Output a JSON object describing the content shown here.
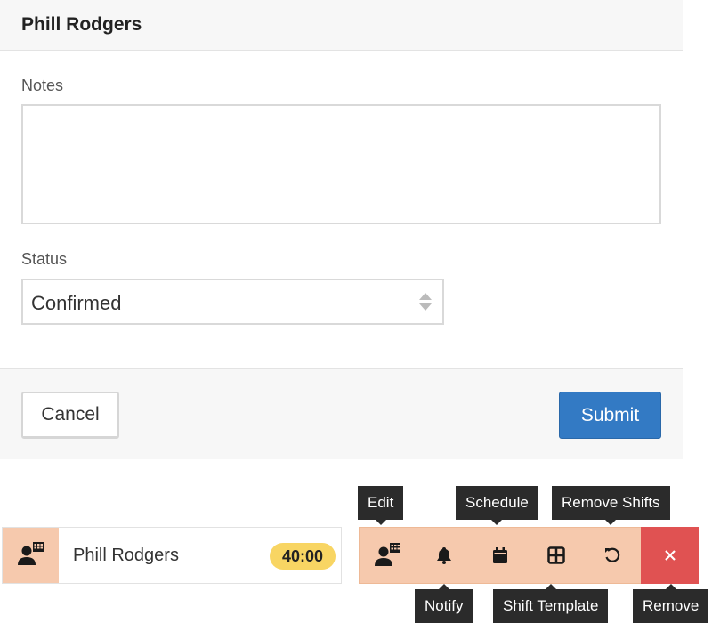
{
  "modal": {
    "title": "Phill Rodgers",
    "notes_label": "Notes",
    "notes_value": "",
    "status_label": "Status",
    "status_value": "Confirmed",
    "cancel_label": "Cancel",
    "submit_label": "Submit"
  },
  "employee_row": {
    "name": "Phill Rodgers",
    "hours": "40:00",
    "icon": "user-schedule-icon"
  },
  "toolbar": {
    "edit_tip": "Edit",
    "notify_tip": "Notify",
    "schedule_tip": "Schedule",
    "shift_template_tip": "Shift Template",
    "remove_shifts_tip": "Remove Shifts",
    "remove_tip": "Remove",
    "icons": [
      "user-schedule-icon",
      "bell-icon",
      "calendar-icon",
      "grid-icon",
      "undo-icon",
      "close-icon"
    ]
  },
  "colors": {
    "accent_peach": "#f6c9ad",
    "submit_blue": "#337ac4",
    "remove_red": "#e05252",
    "badge_yellow": "#f8d563",
    "tooltip_dark": "#2b2b2b"
  }
}
